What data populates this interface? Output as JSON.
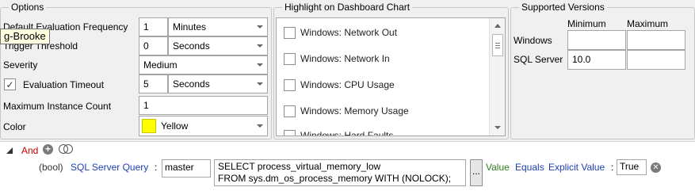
{
  "tooltip": {
    "text": "g-Brooke"
  },
  "options": {
    "legend": "Options",
    "frequency": {
      "label": "Default Evaluation Frequency",
      "value": "1",
      "unit": "Minutes"
    },
    "threshold": {
      "label": "Trigger Threshold",
      "value": "0",
      "unit": "Seconds"
    },
    "severity": {
      "label": "Severity",
      "value": "Medium"
    },
    "timeout": {
      "label": "Evaluation Timeout",
      "checked": true,
      "value": "5",
      "unit": "Seconds"
    },
    "max_instances": {
      "label": "Maximum Instance Count",
      "value": "1"
    },
    "color": {
      "label": "Color",
      "value": "Yellow",
      "swatch": "#ffff00"
    }
  },
  "highlight": {
    "legend": "Highlight on Dashboard Chart",
    "items": [
      {
        "label": "Windows: Network Out",
        "checked": false
      },
      {
        "label": "Windows: Network In",
        "checked": false
      },
      {
        "label": "Windows: CPU Usage",
        "checked": false
      },
      {
        "label": "Windows: Memory Usage",
        "checked": false
      },
      {
        "label": "Windows: Hard Faults",
        "checked": false
      }
    ]
  },
  "versions": {
    "legend": "Supported Versions",
    "col_min": "Minimum",
    "col_max": "Maximum",
    "rows": [
      {
        "label": "Windows",
        "min": "",
        "max": ""
      },
      {
        "label": "SQL Server",
        "min": "10.0",
        "max": ""
      }
    ]
  },
  "condition": {
    "operator": "And",
    "type_prefix": "(bool)",
    "source": "SQL Server Query",
    "colon": ":",
    "database": "master",
    "query_line1": "SELECT process_virtual_memory_low",
    "query_line2": "FROM sys.dm_os_process_memory WITH (NOLOCK);",
    "ellipsis": "...",
    "value_word": "Value",
    "comparison": "Equals",
    "explicit": "Explicit Value",
    "explicit_value": "True"
  }
}
